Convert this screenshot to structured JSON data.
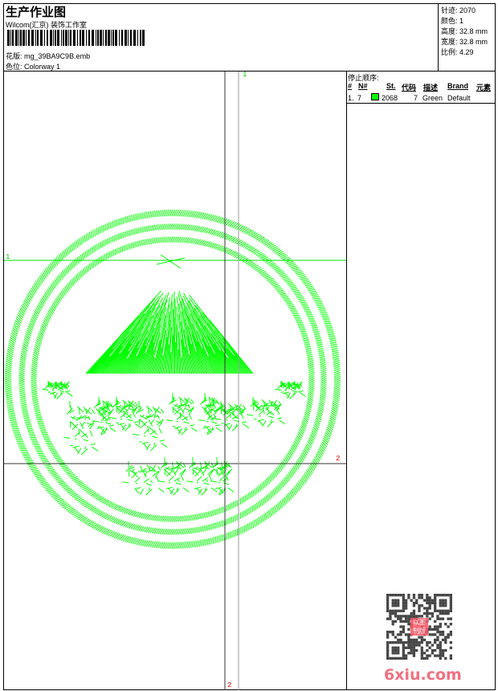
{
  "header": {
    "title": "生产作业图",
    "company": "Wilcom(汇京) 装饰工作室",
    "design_label": "花版:",
    "design_file": "mg_39BA9C9B.emb",
    "colorway_label": "色位:",
    "colorway": "Colorway 1"
  },
  "stats": [
    {
      "label": "针迹:",
      "value": "2070"
    },
    {
      "label": "颜色:",
      "value": "1"
    },
    {
      "label": "高度:",
      "value": "32.8 mm"
    },
    {
      "label": "宽度:",
      "value": "32.8 mm"
    },
    {
      "label": "比例:",
      "value": "4.29"
    }
  ],
  "stop_sequence": {
    "title": "停止顺序:",
    "columns": [
      "#",
      "N#",
      "St.",
      "代码",
      "描述",
      "Brand",
      "元素"
    ],
    "rows": [
      {
        "index": "1.",
        "needle": "7",
        "color": "#00ff00",
        "stitches": "2068",
        "code": "7",
        "description": "Green",
        "brand": "Default",
        "element": ""
      }
    ]
  },
  "canvas": {
    "stitch_color": "#00ff00",
    "guide_markers": {
      "green": "1",
      "red": "2"
    }
  },
  "watermark": {
    "text": "6xiu.com",
    "seal": "以图制版"
  }
}
